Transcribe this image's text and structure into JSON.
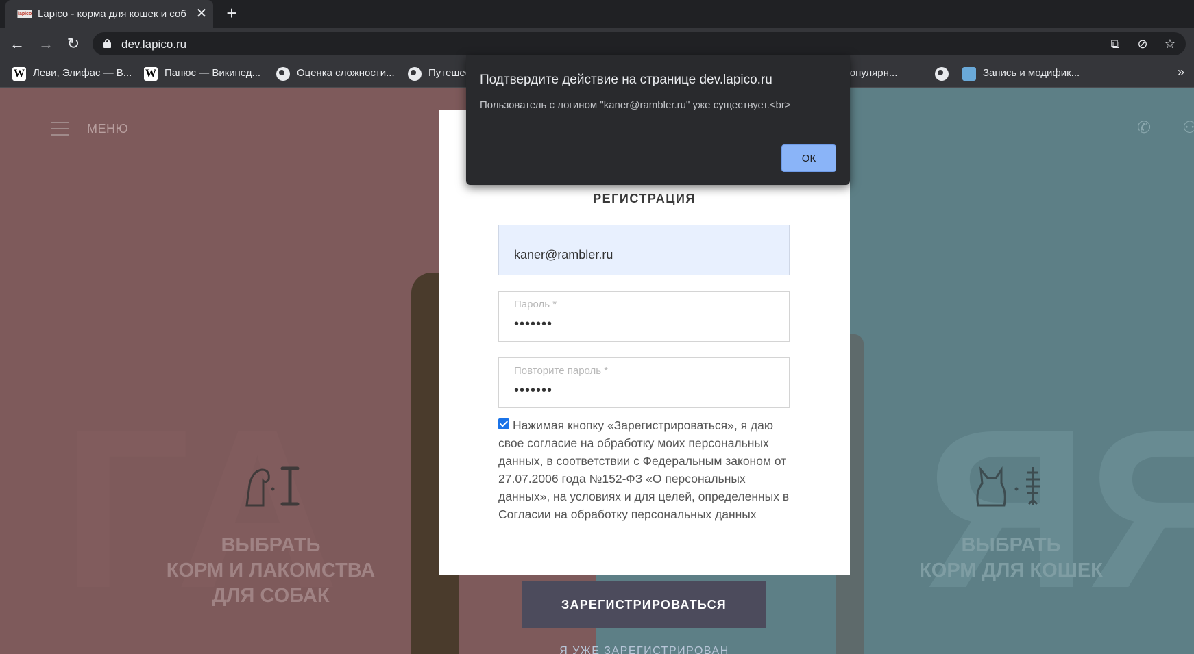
{
  "browser": {
    "tab_title": "Lapico - корма для кошек и соб",
    "tab_favicon_text": "lapico",
    "close_glyph": "✕",
    "new_tab_glyph": "+",
    "url": "dev.lapico.ru"
  },
  "bookmarks": [
    {
      "label": "Леви, Элифас — В...",
      "icon": "wikipedia-icon"
    },
    {
      "label": "Папюс — Википед...",
      "icon": "wikipedia-icon"
    },
    {
      "label": "Оценка сложности...",
      "icon": "globe-icon"
    },
    {
      "label": "Путешес",
      "icon": "globe-icon"
    },
    {
      "label": "но-популярн...",
      "icon": "none"
    },
    {
      "label": "",
      "icon": "globe-icon"
    },
    {
      "label": "Запись и модифик...",
      "icon": "app-icon"
    }
  ],
  "header": {
    "menu_label": "МЕНЮ"
  },
  "sections": {
    "dogs": {
      "line1": "ВЫБРАТЬ",
      "line2": "КОРМ И ЛАКОМСТВА",
      "line3": "ДЛЯ СОБАК"
    },
    "cats": {
      "line1": "ВЫБРАТЬ",
      "line2": "КОРМ ДЛЯ КОШЕК"
    }
  },
  "registration": {
    "title": "РЕГИСТРАЦИЯ",
    "email_value": "kaner@rambler.ru",
    "password_label": "Пароль *",
    "password_value": "•••••••",
    "password_repeat_label": "Повторите пароль *",
    "password_repeat_value": "•••••••",
    "consent_checked": true,
    "consent_text": "Нажимая кнопку «Зарегистрироваться», я даю свое согласие на обработку моих персональных данных, в соответствии с Федеральным законом от 27.07.2006 года №152-ФЗ «О персональных данных», на условиях и для целей, определенных в Согласии на обработку персональных данных",
    "submit_label": "ЗАРЕГИСТРИРОВАТЬСЯ",
    "already_registered_label": "Я УЖЕ ЗАРЕГИСТРИРОВАН"
  },
  "dialog": {
    "title": "Подтвердите действие на странице dev.lapico.ru",
    "message": "Пользователь с логином \"kaner@rambler.ru\" уже существует.<br>",
    "ok_label": "ОК"
  },
  "colors": {
    "left_panel": "#7e5a5b",
    "right_panel": "#5d7f86",
    "submit_button": "#4c4b5c",
    "dialog_bg": "#292a2d",
    "dialog_ok": "#8ab4f8"
  }
}
